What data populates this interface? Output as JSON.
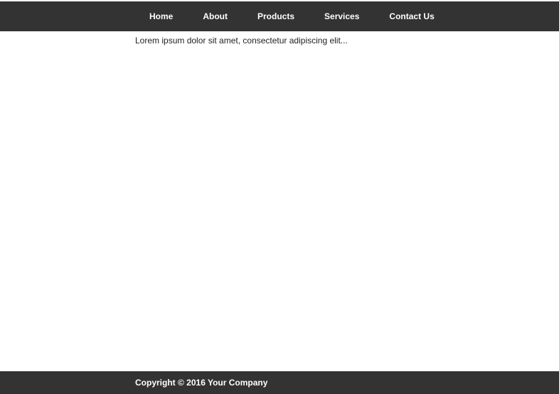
{
  "nav": {
    "items": [
      {
        "label": "Home"
      },
      {
        "label": "About"
      },
      {
        "label": "Products"
      },
      {
        "label": "Services"
      },
      {
        "label": "Contact Us"
      }
    ]
  },
  "main": {
    "text": "Lorem ipsum dolor sit amet, consectetur adipiscing elit..."
  },
  "footer": {
    "copyright": "Copyright © 2016 Your Company"
  },
  "colors": {
    "bar_background": "#333333",
    "bar_text": "#ffffff",
    "body_text": "#222222",
    "page_background": "#ffffff"
  }
}
